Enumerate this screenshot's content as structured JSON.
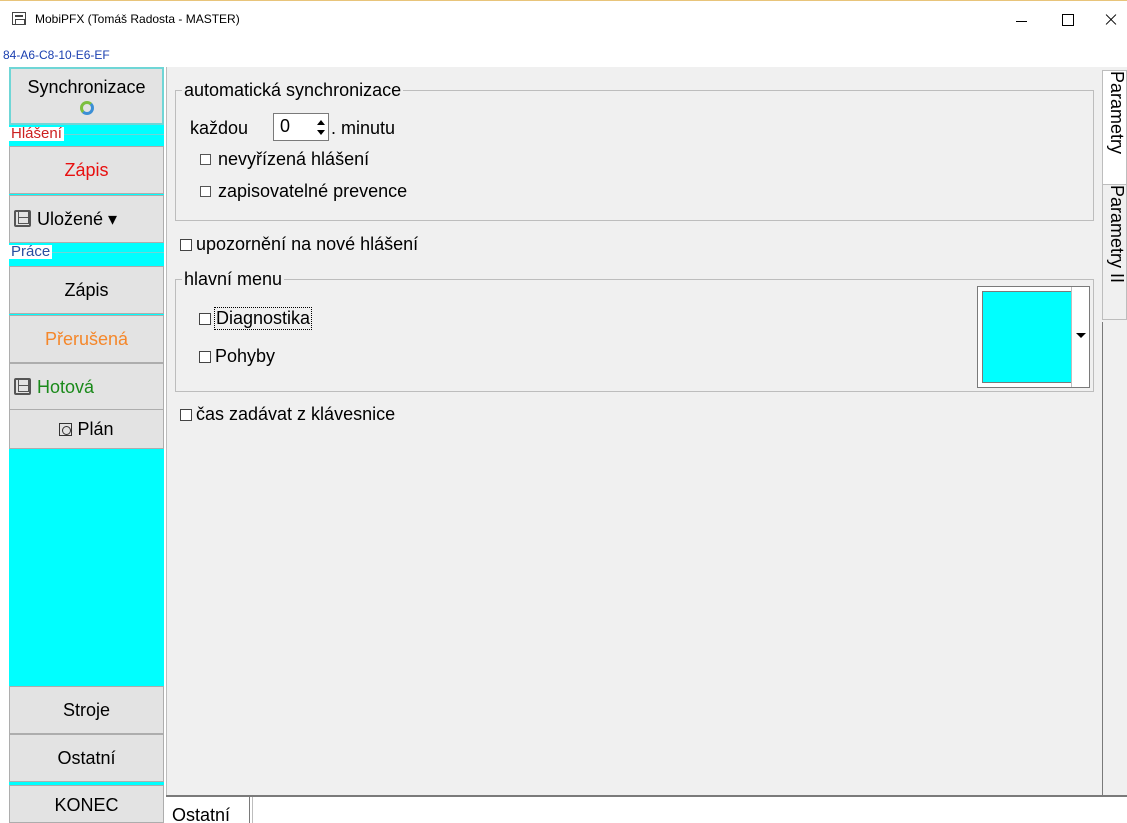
{
  "window": {
    "title": "MobiPFX (Tomáš Radosta - MASTER)",
    "mac_address": "84-A6-C8-10-E6-EF"
  },
  "sidebar": {
    "sync_label": "Synchronizace",
    "group_hlaseni": "Hlášení",
    "hlaseni_zapis": "Zápis",
    "ulozene": "Uložené ▾",
    "group_prace": "Práce",
    "prace_zapis": "Zápis",
    "prerusena": "Přerušená",
    "hotova": "Hotová",
    "plan": "Plán",
    "stroje": "Stroje",
    "ostatni": "Ostatní",
    "konec": "KONEC"
  },
  "main": {
    "auto_sync": {
      "legend": "automatická synchronizace",
      "kazdou": "každou",
      "interval_value": "0",
      "minutu": ". minutu",
      "nevyrizena": "nevyřízená hlášení",
      "zapisovatelne": "zapisovatelné prevence"
    },
    "upozorneni": "upozornění na nové hlášení",
    "hlavni_menu": {
      "legend": "hlavní menu",
      "diagnostika": "Diagnostika",
      "pohyby": "Pohyby",
      "color": "#00ffff"
    },
    "cas_zadavat": "čas zadávat z klávesnice"
  },
  "right_tabs": {
    "tab1": "Parametry",
    "tab2": "Parametry II"
  },
  "bottom_tabs": {
    "tab1": "Ostatní"
  }
}
